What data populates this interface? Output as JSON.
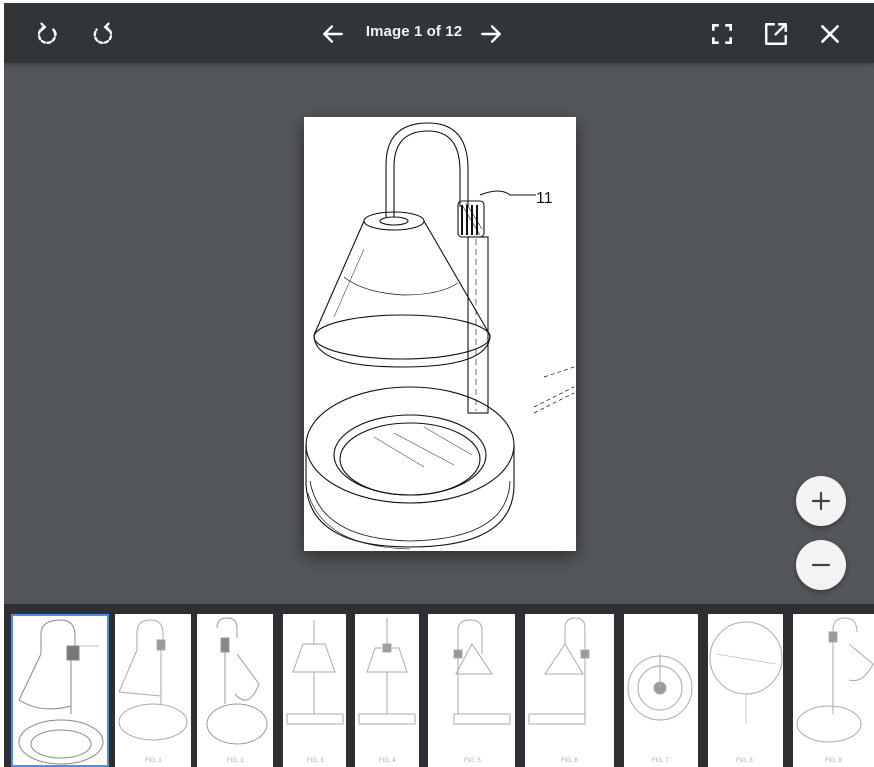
{
  "toolbar": {
    "rotate_left": "rotate-left-icon",
    "rotate_right": "rotate-right-icon",
    "prev": "arrow-left-icon",
    "next": "arrow-right-icon",
    "counter": "Image 1 of 12",
    "fullscreen": "fullscreen-icon",
    "open_new": "open-in-new-icon",
    "close": "close-icon"
  },
  "image": {
    "reference_label": "11"
  },
  "zoom": {
    "in": "zoom-in-icon",
    "out": "zoom-out-icon"
  },
  "colors": {
    "toolbar_bg": "#323538",
    "viewer_bg": "#53565a",
    "strip_bg": "#2d2f32",
    "selected_outline": "#4a8fe8"
  },
  "thumbnails": {
    "selected_index": 0,
    "count_visible": 10
  }
}
